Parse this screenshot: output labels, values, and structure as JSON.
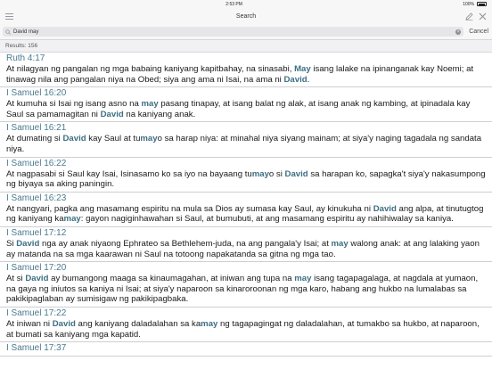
{
  "status_bar": {
    "time": "2:53 PM",
    "battery": "100%"
  },
  "nav": {
    "title": "Search"
  },
  "search": {
    "value": "David may",
    "cancel_label": "Cancel"
  },
  "results_count": "Results: 156",
  "results": [
    {
      "ref": "Ruth 4:17",
      "parts": [
        {
          "t": "At nilagyan ng pangalan ng mga babaing kaniyang kapitbahay, na sinasabi, "
        },
        {
          "t": "May",
          "h": true
        },
        {
          "t": " isang lalake na ipinanganak kay Noemi; at tinawag nila ang pangalan niya na Obed; siya ang ama ni Isai, na ama ni "
        },
        {
          "t": "David",
          "h": true
        },
        {
          "t": "."
        }
      ]
    },
    {
      "ref": "I Samuel 16:20",
      "parts": [
        {
          "t": "At kumuha si Isai ng isang asno na "
        },
        {
          "t": "may",
          "h": true
        },
        {
          "t": " pasang tinapay, at isang balat ng alak, at isang anak ng kambing, at ipinadala kay Saul sa pamamagitan ni "
        },
        {
          "t": "David",
          "h": true
        },
        {
          "t": " na kaniyang anak."
        }
      ]
    },
    {
      "ref": "I Samuel 16:21",
      "parts": [
        {
          "t": "At dumating si "
        },
        {
          "t": "David",
          "h": true
        },
        {
          "t": " kay Saul at tu"
        },
        {
          "t": "may",
          "h": true
        },
        {
          "t": "o sa harap niya: at minahal niya siyang mainam; at siya'y naging tagadala ng sandata niya."
        }
      ]
    },
    {
      "ref": "I Samuel 16:22",
      "parts": [
        {
          "t": "At nagpasabi si Saul kay Isai, Isinasamo ko sa iyo na bayaang tu"
        },
        {
          "t": "may",
          "h": true
        },
        {
          "t": "o si "
        },
        {
          "t": "David",
          "h": true
        },
        {
          "t": " sa harapan ko, sapagka't siya'y nakasumpong ng biyaya sa aking paningin."
        }
      ]
    },
    {
      "ref": "I Samuel 16:23",
      "parts": [
        {
          "t": "At nangyari, pagka ang masamang espiritu na mula sa Dios ay sumasa kay Saul, ay kinukuha ni "
        },
        {
          "t": "David",
          "h": true
        },
        {
          "t": " ang alpa, at tinutugtog ng kaniyang ka"
        },
        {
          "t": "may",
          "h": true
        },
        {
          "t": ": gayon nagiginhawahan si Saul, at bumubuti, at ang masamang espiritu ay nahihiwalay sa kaniya."
        }
      ]
    },
    {
      "ref": "I Samuel 17:12",
      "parts": [
        {
          "t": "Si "
        },
        {
          "t": "David",
          "h": true
        },
        {
          "t": " nga ay anak niyaong Ephrateo sa Bethlehem-juda, na ang pangala'y Isai; at "
        },
        {
          "t": "may",
          "h": true
        },
        {
          "t": " walong anak: at ang lalaking yaon ay matanda na sa mga kaarawan ni Saul na totoong napakatanda sa gitna ng mga tao."
        }
      ]
    },
    {
      "ref": "I Samuel 17:20",
      "parts": [
        {
          "t": "At si "
        },
        {
          "t": "David",
          "h": true
        },
        {
          "t": " ay bumangong maaga sa kinaumagahan, at iniwan ang tupa na "
        },
        {
          "t": "may",
          "h": true
        },
        {
          "t": " isang tagapagalaga, at nagdala at yumaon, na gaya ng iniutos sa kaniya ni Isai; at siya'y naparoon sa kinaroroonan ng mga karo, habang ang hukbo na lumalabas sa pakikipaglaban ay sumisigaw ng pakikipagbaka."
        }
      ]
    },
    {
      "ref": "I Samuel 17:22",
      "parts": [
        {
          "t": "At iniwan ni "
        },
        {
          "t": "David",
          "h": true
        },
        {
          "t": " ang kaniyang daladalahan sa ka"
        },
        {
          "t": "may",
          "h": true
        },
        {
          "t": " ng tagapagingat ng daladalahan, at tumakbo sa hukbo, at naparoon, at bumati sa kaniyang mga kapatid."
        }
      ]
    },
    {
      "ref": "I Samuel 17:37",
      "parts": []
    }
  ]
}
